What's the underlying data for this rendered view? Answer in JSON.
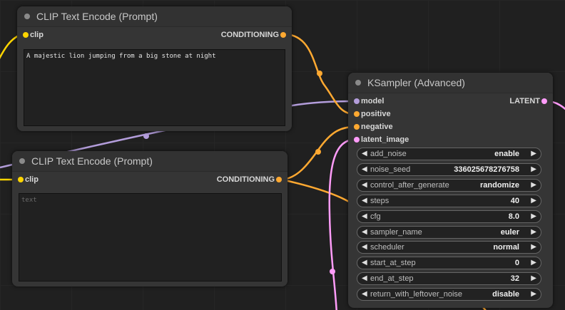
{
  "nodes": {
    "clip_encode_top": {
      "title": "CLIP Text Encode (Prompt)",
      "input_label": "clip",
      "output_label": "CONDITIONING",
      "text_value": "A majestic lion jumping from a big stone at night"
    },
    "clip_encode_bottom": {
      "title": "CLIP Text Encode (Prompt)",
      "input_label": "clip",
      "output_label": "CONDITIONING",
      "text_value": "",
      "text_placeholder": "text"
    },
    "ksampler": {
      "title": "KSampler (Advanced)",
      "inputs": [
        "model",
        "positive",
        "negative",
        "latent_image"
      ],
      "output_label": "LATENT",
      "widgets": [
        {
          "name": "add_noise",
          "value": "enable"
        },
        {
          "name": "noise_seed",
          "value": "336025678276758"
        },
        {
          "name": "control_after_generate",
          "value": "randomize"
        },
        {
          "name": "steps",
          "value": "40"
        },
        {
          "name": "cfg",
          "value": "8.0"
        },
        {
          "name": "sampler_name",
          "value": "euler"
        },
        {
          "name": "scheduler",
          "value": "normal"
        },
        {
          "name": "start_at_step",
          "value": "0"
        },
        {
          "name": "end_at_step",
          "value": "32"
        },
        {
          "name": "return_with_leftover_noise",
          "value": "disable"
        }
      ]
    }
  },
  "colors": {
    "clip": "#FFD500",
    "conditioning": "#FFA931",
    "model": "#B39DDB",
    "latent": "#FF9CF9",
    "canvas": "#202020",
    "node_body": "#353535"
  },
  "icons": {
    "decrement": "◀",
    "increment": "▶"
  }
}
